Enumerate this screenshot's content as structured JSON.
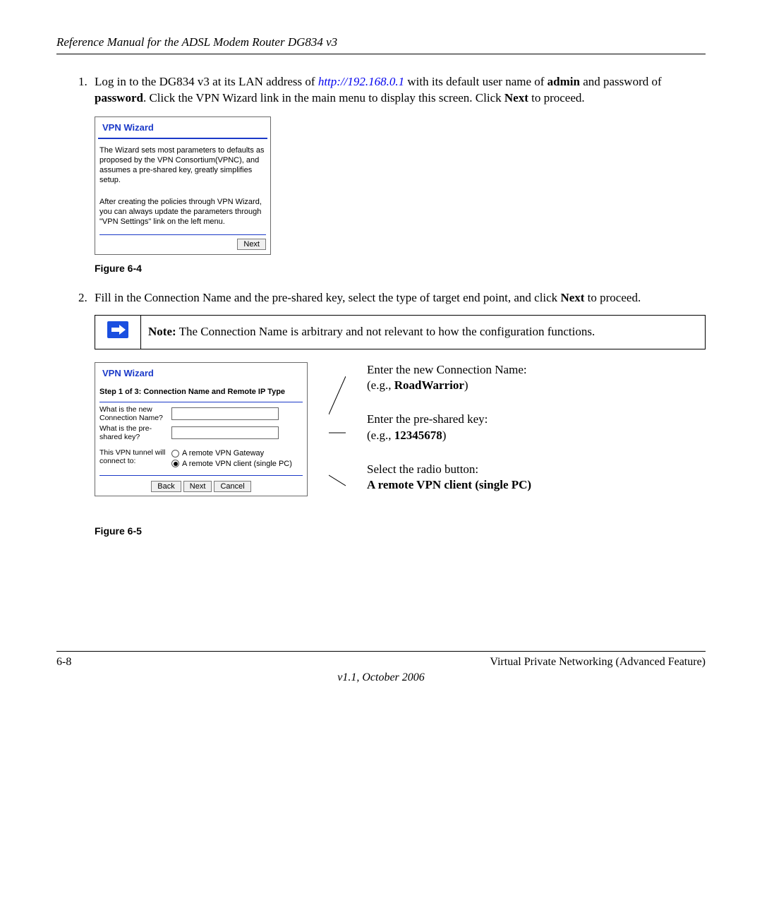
{
  "header": {
    "title": "Reference Manual for the ADSL Modem Router DG834 v3"
  },
  "steps": {
    "s1": {
      "num": "1.",
      "t1": "Log in to the DG834 v3 at its LAN address of ",
      "link": "http://192.168.0.1",
      "t2": " with its default user name of ",
      "admin": "admin",
      "t3": " and password of ",
      "pwd": "password",
      "t4": ". Click the VPN Wizard link in the main menu to display this screen. Click ",
      "next": "Next",
      "t5": " to proceed."
    },
    "s2": {
      "num": "2.",
      "t1": "Fill in the Connection Name and the pre-shared key, select the type of target end point, and click ",
      "next": "Next",
      "t2": " to proceed."
    }
  },
  "fig4": {
    "win_title": "VPN Wizard",
    "p1": "The Wizard sets most parameters to defaults as proposed by the VPN Consortium(VPNC), and assumes a pre-shared key, greatly simplifies setup.",
    "p2": "After creating the policies through VPN Wizard, you can always update the parameters through \"VPN Settings\" link on the left menu.",
    "btn_next": "Next",
    "caption": "Figure 6-4"
  },
  "note": {
    "label": "Note:",
    "text": " The Connection Name is arbitrary and not relevant to how the configuration functions."
  },
  "fig5": {
    "win_title": "VPN Wizard",
    "step_label": "Step 1 of 3: Connection Name and Remote IP Type",
    "q1": "What is the new Connection Name?",
    "q2": "What is the pre-shared key?",
    "q3": "This VPN tunnel will connect to:",
    "opt1": "A remote VPN Gateway",
    "opt2": "A remote VPN client (single PC)",
    "btn_back": "Back",
    "btn_next": "Next",
    "btn_cancel": "Cancel",
    "caption": "Figure 6-5",
    "annot1a": "Enter the new Connection Name:",
    "annot1b_pre": "(e.g., ",
    "annot1b_bold": "RoadWarrior",
    "annot1b_post": ")",
    "annot2a": "Enter the pre-shared key:",
    "annot2b_pre": "(e.g., ",
    "annot2b_bold": "12345678",
    "annot2b_post": ")",
    "annot3a": "Select the radio button:",
    "annot3b": "A remote VPN client (single PC)"
  },
  "footer": {
    "page": "6-8",
    "section": "Virtual Private Networking (Advanced Feature)",
    "version": "v1.1, October 2006"
  }
}
